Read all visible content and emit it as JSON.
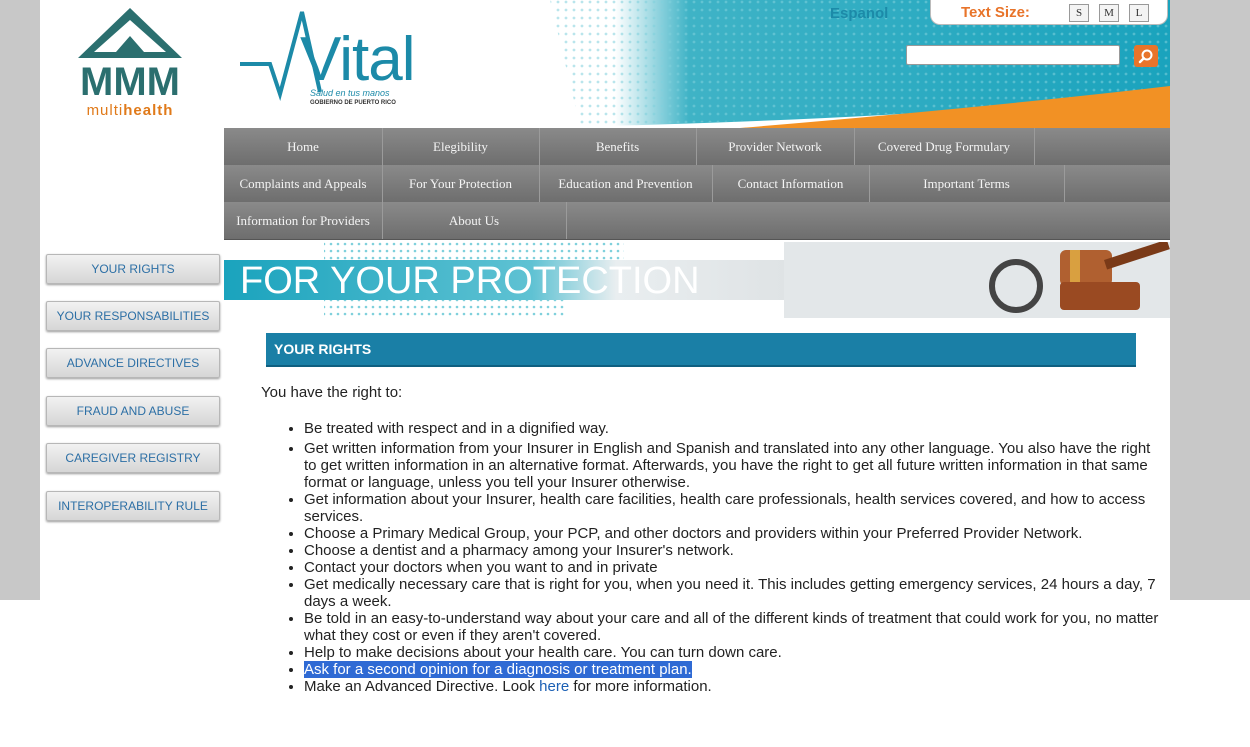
{
  "header": {
    "brand_main": "MMM",
    "brand_sub_a": "multi",
    "brand_sub_b": "health",
    "vital_word": "Vital",
    "vital_tagline": "Salud en tus manos",
    "vital_gov": "GOBIERNO DE PUERTO RICO",
    "language_link": "Espanol",
    "text_size_label": "Text Size:",
    "text_size_options": [
      "S",
      "M",
      "L"
    ],
    "search": {
      "value": "",
      "placeholder": ""
    }
  },
  "nav": {
    "row1": [
      "Home",
      "Elegibility",
      "Benefits",
      "Provider Network",
      "Covered Drug Formulary"
    ],
    "row2": [
      "Complaints and Appeals",
      "For Your Protection",
      "Education and Prevention",
      "Contact Information",
      "Important Terms"
    ],
    "row3": [
      "Information for Providers",
      "About Us"
    ]
  },
  "sidebar": {
    "items": [
      "YOUR RIGHTS",
      "YOUR RESPONSABILITIES",
      "ADVANCE DIRECTIVES",
      "FRAUD AND ABUSE",
      "CAREGIVER REGISTRY",
      "INTEROPERABILITY RULE"
    ]
  },
  "banner": {
    "title": "FOR YOUR PROTECTION"
  },
  "content": {
    "section_title": "YOUR RIGHTS",
    "intro": "You have the right to:",
    "rights": [
      "Be treated with respect and in a dignified way.",
      "Get written information from your Insurer in English and Spanish and translated into any other language. You also have the right to get written information in an alternative format. Afterwards, you have the right to get all future written information in that same format or language, unless you tell your Insurer otherwise.",
      "Get information about your Insurer, health care facilities, health care professionals, health services covered, and how to access services.",
      "Choose a Primary Medical Group, your PCP, and other doctors and providers within your Preferred Provider Network.",
      "Choose a dentist and a pharmacy among your Insurer's network.",
      "Contact your doctors when you want to and in private",
      "Get medically necessary care that is right for you, when you need it. This includes getting emergency services, 24 hours a day, 7 days a week.",
      "Be told in an easy-to-understand way about your care and all of the different kinds of treatment that could work for you, no matter what they cost or even if they aren't covered.",
      "Help to make decisions about your health care. You can turn down care.",
      "Ask for a second opinion for a diagnosis or treatment plan."
    ],
    "last_item_before": "Make an Advanced Directive. Look ",
    "last_item_link": "here",
    "last_item_after": " for more information."
  }
}
